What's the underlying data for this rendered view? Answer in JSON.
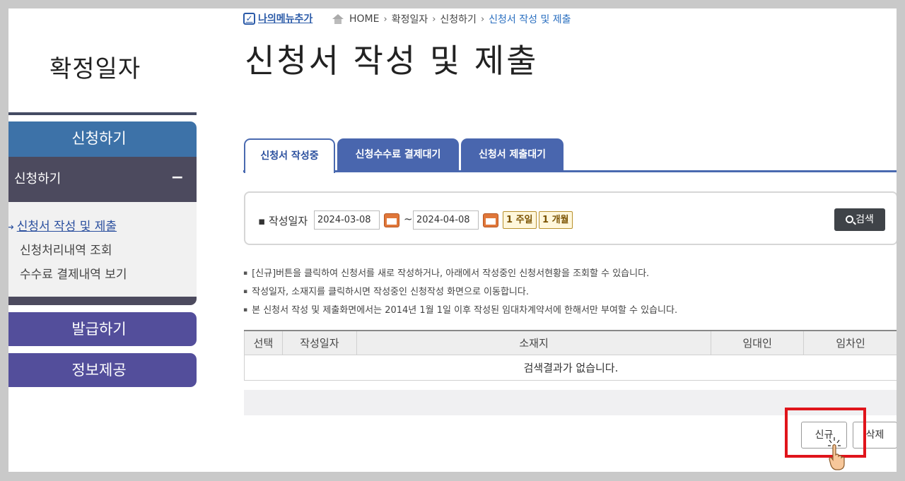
{
  "sidebar": {
    "title": "확정일자",
    "categories": {
      "apply": "신청하기",
      "issue": "발급하기",
      "info": "정보제공"
    },
    "sub_head": "신청하기",
    "sub_head_toggle": "−",
    "items": [
      {
        "label": "신청서 작성 및 제출",
        "arrow": "→"
      },
      {
        "label": "신청처리내역 조회"
      },
      {
        "label": "수수료 결제내역 보기"
      }
    ]
  },
  "header": {
    "my_menu": "나의메뉴추가",
    "breadcrumb": [
      "HOME",
      "확정일자",
      "신청하기",
      "신청서 작성 및 제출"
    ],
    "title": "신청서 작성 및 제출"
  },
  "tabs": [
    {
      "label": "신청서 작성중",
      "active": true
    },
    {
      "label": "신청수수료 결제대기",
      "active": false
    },
    {
      "label": "신청서 제출대기",
      "active": false
    }
  ],
  "search": {
    "label": "작성일자",
    "from": "2024-03-08",
    "to": "2024-04-08",
    "range_sep": "~",
    "week_btn": "1 주일",
    "month_btn": "1 개월",
    "search_btn": "검색"
  },
  "notes": [
    "[신규]버튼을 클릭하여 신청서를 새로 작성하거나, 아래에서 작성중인 신청서현황을 조회할 수 있습니다.",
    "작성일자, 소재지를 클릭하시면 작성중인 신청작성 화면으로 이동합니다.",
    "본 신청서 작성 및 제출화면에서는 2014년 1월 1일 이후 작성된 임대차계약서에 한해서만 부여할 수 있습니다."
  ],
  "table": {
    "columns": [
      "선택",
      "작성일자",
      "소재지",
      "임대인",
      "임차인"
    ],
    "empty_message": "검색결과가 없습니다."
  },
  "actions": {
    "new_btn": "신규",
    "delete_btn": "삭제"
  },
  "colors": {
    "accent_blue": "#3d72a8",
    "tab_blue": "#4966ae",
    "category_purple": "#534e9b",
    "highlight_red": "#e0141b"
  }
}
